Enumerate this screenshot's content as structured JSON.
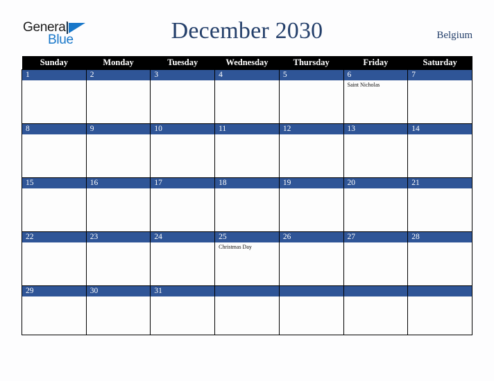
{
  "header": {
    "logo": {
      "word1": "General",
      "word2": "Blue",
      "triangle_icon": "blue-triangle-icon",
      "brand_color": "#1877c9"
    },
    "title": "December 2030",
    "region": "Belgium",
    "title_color": "#25406b"
  },
  "calendar": {
    "month": "December",
    "year": "2030",
    "weekday_headers": [
      "Sunday",
      "Monday",
      "Tuesday",
      "Wednesday",
      "Thursday",
      "Friday",
      "Saturday"
    ],
    "header_bg": "#000000",
    "daynum_band_color": "#2f5597",
    "cell_bg": "#fdfdfd",
    "weeks": [
      [
        {
          "day": "1",
          "events": []
        },
        {
          "day": "2",
          "events": []
        },
        {
          "day": "3",
          "events": []
        },
        {
          "day": "4",
          "events": []
        },
        {
          "day": "5",
          "events": []
        },
        {
          "day": "6",
          "events": [
            "Saint Nicholas"
          ]
        },
        {
          "day": "7",
          "events": []
        }
      ],
      [
        {
          "day": "8",
          "events": []
        },
        {
          "day": "9",
          "events": []
        },
        {
          "day": "10",
          "events": []
        },
        {
          "day": "11",
          "events": []
        },
        {
          "day": "12",
          "events": []
        },
        {
          "day": "13",
          "events": []
        },
        {
          "day": "14",
          "events": []
        }
      ],
      [
        {
          "day": "15",
          "events": []
        },
        {
          "day": "16",
          "events": []
        },
        {
          "day": "17",
          "events": []
        },
        {
          "day": "18",
          "events": []
        },
        {
          "day": "19",
          "events": []
        },
        {
          "day": "20",
          "events": []
        },
        {
          "day": "21",
          "events": []
        }
      ],
      [
        {
          "day": "22",
          "events": []
        },
        {
          "day": "23",
          "events": []
        },
        {
          "day": "24",
          "events": []
        },
        {
          "day": "25",
          "events": [
            "Christmas Day"
          ]
        },
        {
          "day": "26",
          "events": []
        },
        {
          "day": "27",
          "events": []
        },
        {
          "day": "28",
          "events": []
        }
      ],
      [
        {
          "day": "29",
          "events": []
        },
        {
          "day": "30",
          "events": []
        },
        {
          "day": "31",
          "events": []
        },
        {
          "day": "",
          "events": []
        },
        {
          "day": "",
          "events": []
        },
        {
          "day": "",
          "events": []
        },
        {
          "day": "",
          "events": []
        }
      ]
    ]
  }
}
